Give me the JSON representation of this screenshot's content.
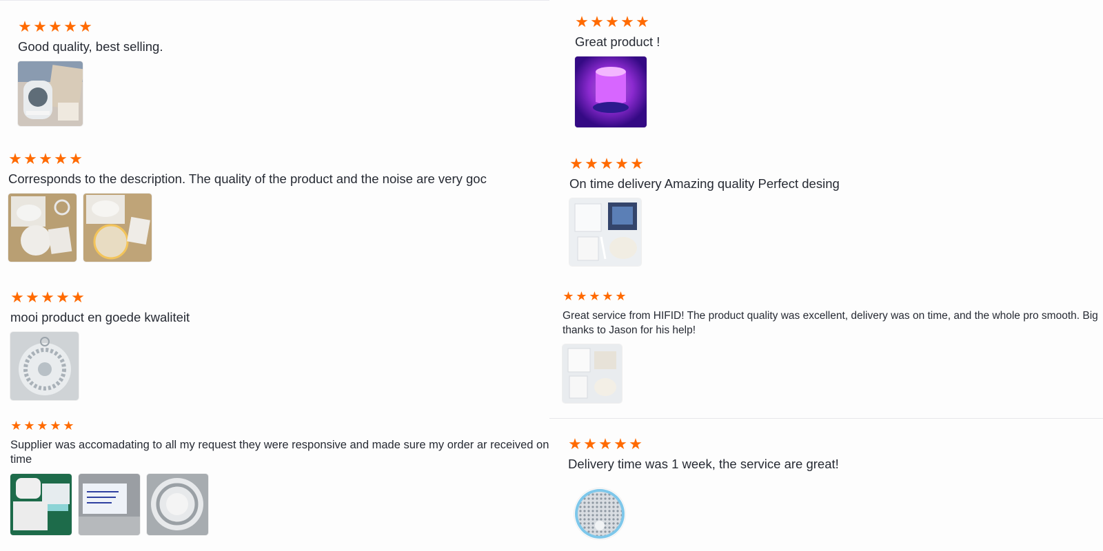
{
  "reviews_left": [
    {
      "rating": 5,
      "comment": "Good quality, best selling.",
      "photos": [
        {
          "icon": "product-box-photo"
        }
      ]
    },
    {
      "rating": 5,
      "comment": "Corresponds to the description. The quality of the product and the noise are very goc",
      "photos": [
        {
          "icon": "product-photo"
        },
        {
          "icon": "product-photo"
        }
      ]
    },
    {
      "rating": 5,
      "comment": "mooi product en goede kwaliteit",
      "photos": [
        {
          "icon": "product-photo"
        }
      ]
    },
    {
      "rating": 5,
      "comment": "Supplier was accomadating to all my request they were responsive and made sure my order ar received on time",
      "photos": [
        {
          "icon": "product-photo"
        },
        {
          "icon": "label-photo"
        },
        {
          "icon": "product-photo"
        }
      ]
    }
  ],
  "reviews_right": [
    {
      "rating": 5,
      "comment": "Great product !",
      "photos": [
        {
          "icon": "purple-lamp-photo"
        }
      ]
    },
    {
      "rating": 5,
      "comment": "On time delivery Amazing quality Perfect desing",
      "photos": [
        {
          "icon": "product-kit-photo"
        }
      ]
    },
    {
      "rating": 5,
      "comment": "Great service from HIFID! The product quality was excellent, delivery was on time, and the whole pro smooth. Big thanks to Jason for his help!",
      "photos": [
        {
          "icon": "product-kit-photo"
        }
      ]
    },
    {
      "rating": 5,
      "comment": "Delivery time was 1 week, the service are great!",
      "photos": [
        {
          "icon": "round-speaker-photo"
        }
      ]
    }
  ],
  "colors": {
    "star": "#ff6a00",
    "text": "#262a33",
    "lamp": "#c23cff"
  }
}
